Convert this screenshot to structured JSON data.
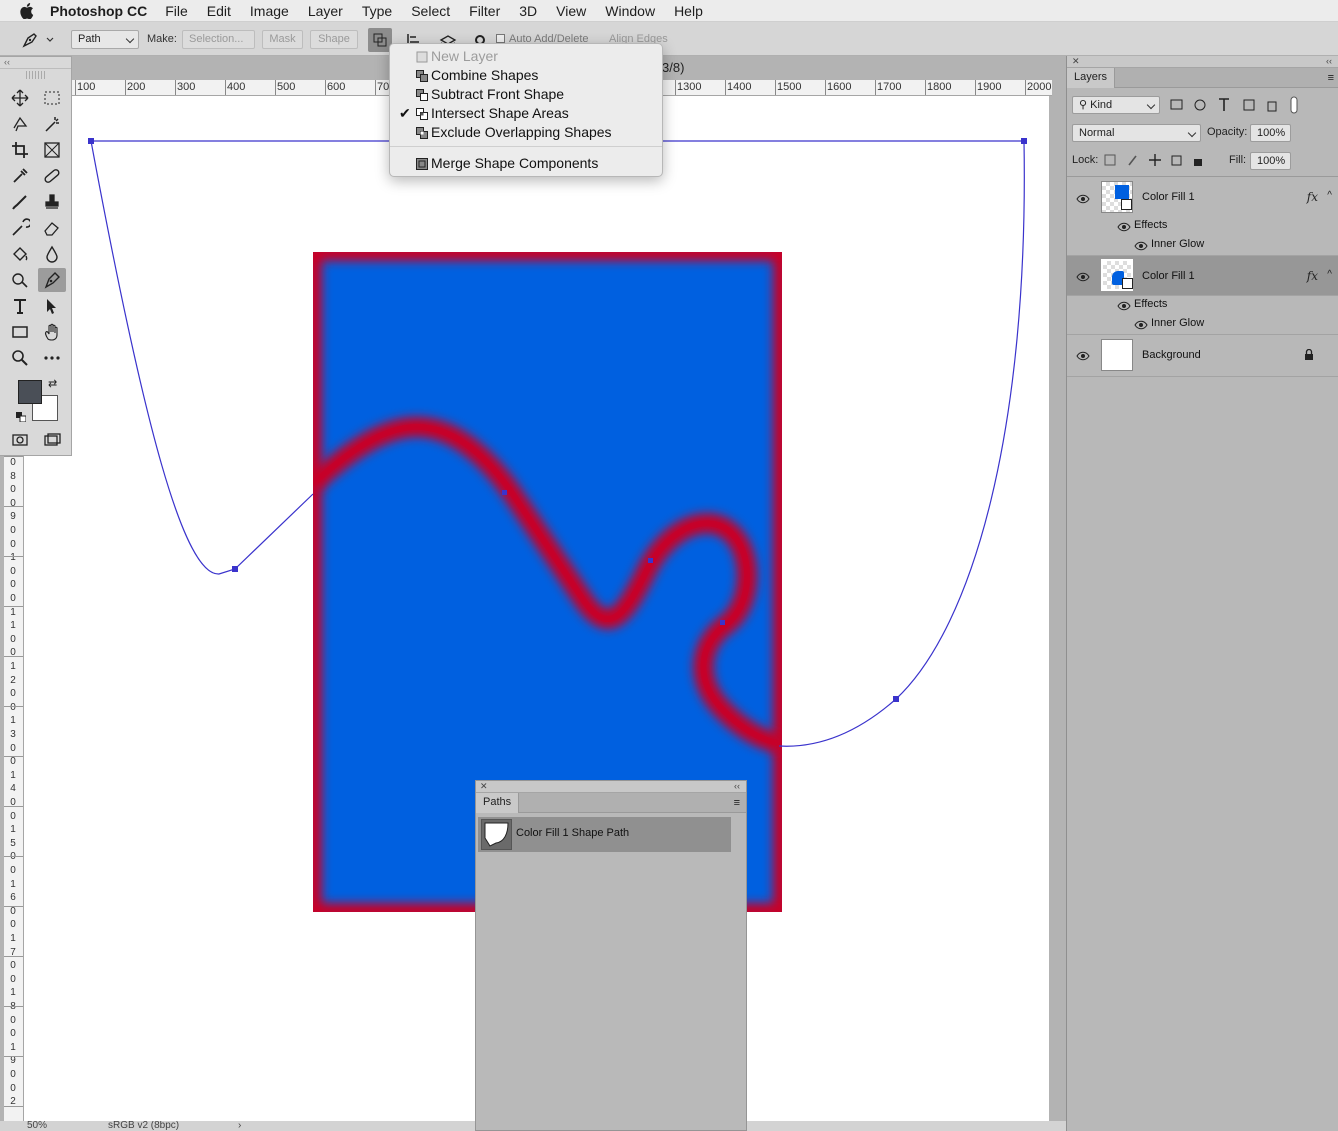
{
  "menubar": {
    "app_name": "Photoshop CC",
    "items": [
      "File",
      "Edit",
      "Image",
      "Layer",
      "Type",
      "Select",
      "Filter",
      "3D",
      "View",
      "Window",
      "Help"
    ]
  },
  "options_bar": {
    "tool_mode": "Path",
    "make_label": "Make:",
    "selection_button": "Selection...",
    "mask_button": "Mask",
    "shape_button": "Shape",
    "auto_add_delete": "Auto Add/Delete",
    "align_edges": "Align Edges"
  },
  "path_operations_menu": {
    "items": [
      {
        "label": "New Layer",
        "enabled": false,
        "checked": false
      },
      {
        "label": "Combine Shapes",
        "enabled": true,
        "checked": false
      },
      {
        "label": "Subtract Front Shape",
        "enabled": true,
        "checked": false
      },
      {
        "label": "Intersect Shape Areas",
        "enabled": true,
        "checked": true
      },
      {
        "label": "Exclude Overlapping Shapes",
        "enabled": true,
        "checked": false
      },
      {
        "label": "Merge Shape Components",
        "enabled": true,
        "checked": false
      }
    ]
  },
  "document": {
    "title_fragment": "3/8)",
    "ruler_labels": [
      "100",
      "200",
      "300",
      "400",
      "500",
      "600",
      "70",
      "1300",
      "1400",
      "1500",
      "1600",
      "1700",
      "1800",
      "1900",
      "2000"
    ],
    "vruler_labels": [
      "0",
      "8",
      "0",
      "0",
      "9",
      "0",
      "0",
      "1",
      "0",
      "0",
      "0",
      "1",
      "1",
      "0",
      "0",
      "1",
      "2",
      "0",
      "0",
      "1",
      "3",
      "0",
      "0",
      "1",
      "4",
      "0",
      "0",
      "1",
      "5",
      "0",
      "0",
      "1",
      "6",
      "0",
      "0",
      "1",
      "7",
      "0",
      "0",
      "1",
      "8",
      "0",
      "0",
      "1",
      "9",
      "0",
      "0",
      "2"
    ],
    "zoom": "50%",
    "color_profile": "sRGB v2 (8bpc)",
    "fill_color": "#0060e0",
    "glow_color": "#c80028",
    "path_color": "#3a33cc"
  },
  "layers_panel": {
    "tab": "Layers",
    "filter_kind": "Kind",
    "blend_mode": "Normal",
    "opacity_label": "Opacity:",
    "opacity_value": "100%",
    "lock_label": "Lock:",
    "fill_label": "Fill:",
    "fill_value": "100%",
    "layers": [
      {
        "name": "Color Fill 1",
        "fx": "fx",
        "effects_label": "Effects",
        "effect": "Inner Glow",
        "selected": false
      },
      {
        "name": "Color Fill 1",
        "fx": "fx",
        "effects_label": "Effects",
        "effect": "Inner Glow",
        "selected": true
      },
      {
        "name": "Background",
        "locked": true
      }
    ]
  },
  "paths_panel": {
    "tab": "Paths",
    "paths": [
      {
        "name": "Color Fill 1 Shape Path"
      }
    ]
  }
}
